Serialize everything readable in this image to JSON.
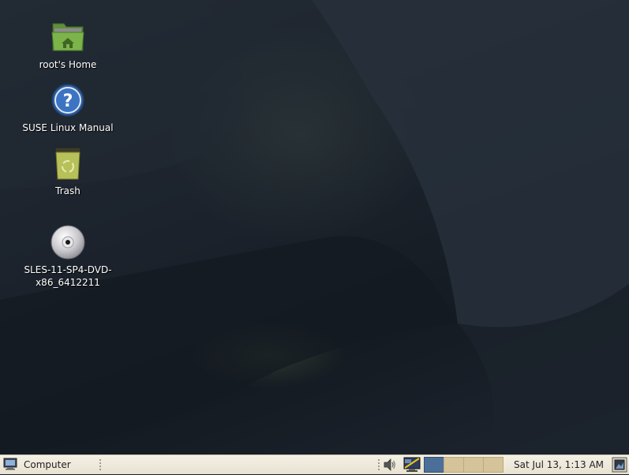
{
  "desktop": {
    "icons": [
      {
        "label": "root's Home",
        "icon": "home-folder-icon"
      },
      {
        "label": "SUSE Linux Manual",
        "icon": "help-icon"
      },
      {
        "label": "Trash",
        "icon": "trash-icon"
      },
      {
        "label_line1": "SLES-11-SP4-DVD-",
        "label_line2": "x86_6412211",
        "icon": "dvd-icon"
      }
    ]
  },
  "panel": {
    "menu_label": "Computer",
    "menu_icon": "computer-icon",
    "tray": {
      "volume_icon": "speaker-icon",
      "network_icon": "network-icon"
    },
    "workspaces": {
      "count": 4,
      "active_index": 0
    },
    "clock": "Sat Jul 13,  1:13 AM",
    "show_desktop_icon": "show-desktop-icon"
  },
  "colors": {
    "panel_bg": "#f0ebdc",
    "workspace_active": "#4c6f9a",
    "workspace_inactive": "#d5c39a"
  }
}
